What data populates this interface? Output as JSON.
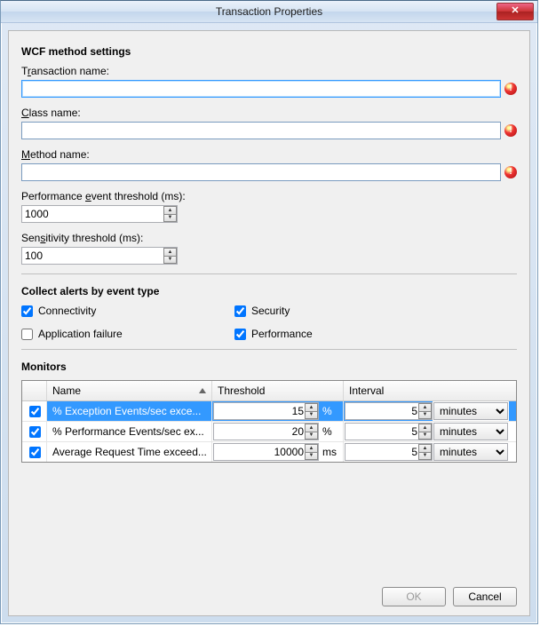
{
  "window": {
    "title": "Transaction Properties",
    "close_glyph": "✕"
  },
  "wcf": {
    "heading": "WCF method settings",
    "transaction_name": {
      "label_pre": "T",
      "label_u": "r",
      "label_post": "ansaction name:",
      "value": ""
    },
    "class_name": {
      "label_pre": "",
      "label_u": "C",
      "label_post": "lass name:",
      "value": ""
    },
    "method_name": {
      "label_pre": "",
      "label_u": "M",
      "label_post": "ethod name:",
      "value": ""
    },
    "perf_threshold": {
      "label_pre": "Performance ",
      "label_u": "e",
      "label_post": "vent threshold (ms):",
      "value": "1000"
    },
    "sensitivity_threshold": {
      "label_pre": "Sen",
      "label_u": "s",
      "label_post": "itivity threshold (ms):",
      "value": "100"
    },
    "error_glyph": "!"
  },
  "alerts": {
    "heading": "Collect alerts by event type",
    "items": [
      {
        "label": "Connectivity",
        "checked": true
      },
      {
        "label": "Security",
        "checked": true
      },
      {
        "label": "Application failure",
        "checked": false
      },
      {
        "label": "Performance",
        "checked": true
      }
    ]
  },
  "monitors": {
    "heading": "Monitors",
    "headers": {
      "name": "Name",
      "threshold": "Threshold",
      "interval": "Interval"
    },
    "rows": [
      {
        "selected": true,
        "enabled": true,
        "name": "% Exception Events/sec exce...",
        "threshold": "15",
        "unit": "%",
        "interval": "5",
        "interval_unit": "minutes"
      },
      {
        "selected": false,
        "enabled": true,
        "name": "% Performance Events/sec ex...",
        "threshold": "20",
        "unit": "%",
        "interval": "5",
        "interval_unit": "minutes"
      },
      {
        "selected": false,
        "enabled": true,
        "name": "Average Request Time exceed...",
        "threshold": "10000",
        "unit": "ms",
        "interval": "5",
        "interval_unit": "minutes"
      }
    ],
    "interval_unit_options": [
      "minutes"
    ]
  },
  "buttons": {
    "ok": "OK",
    "cancel": "Cancel"
  }
}
